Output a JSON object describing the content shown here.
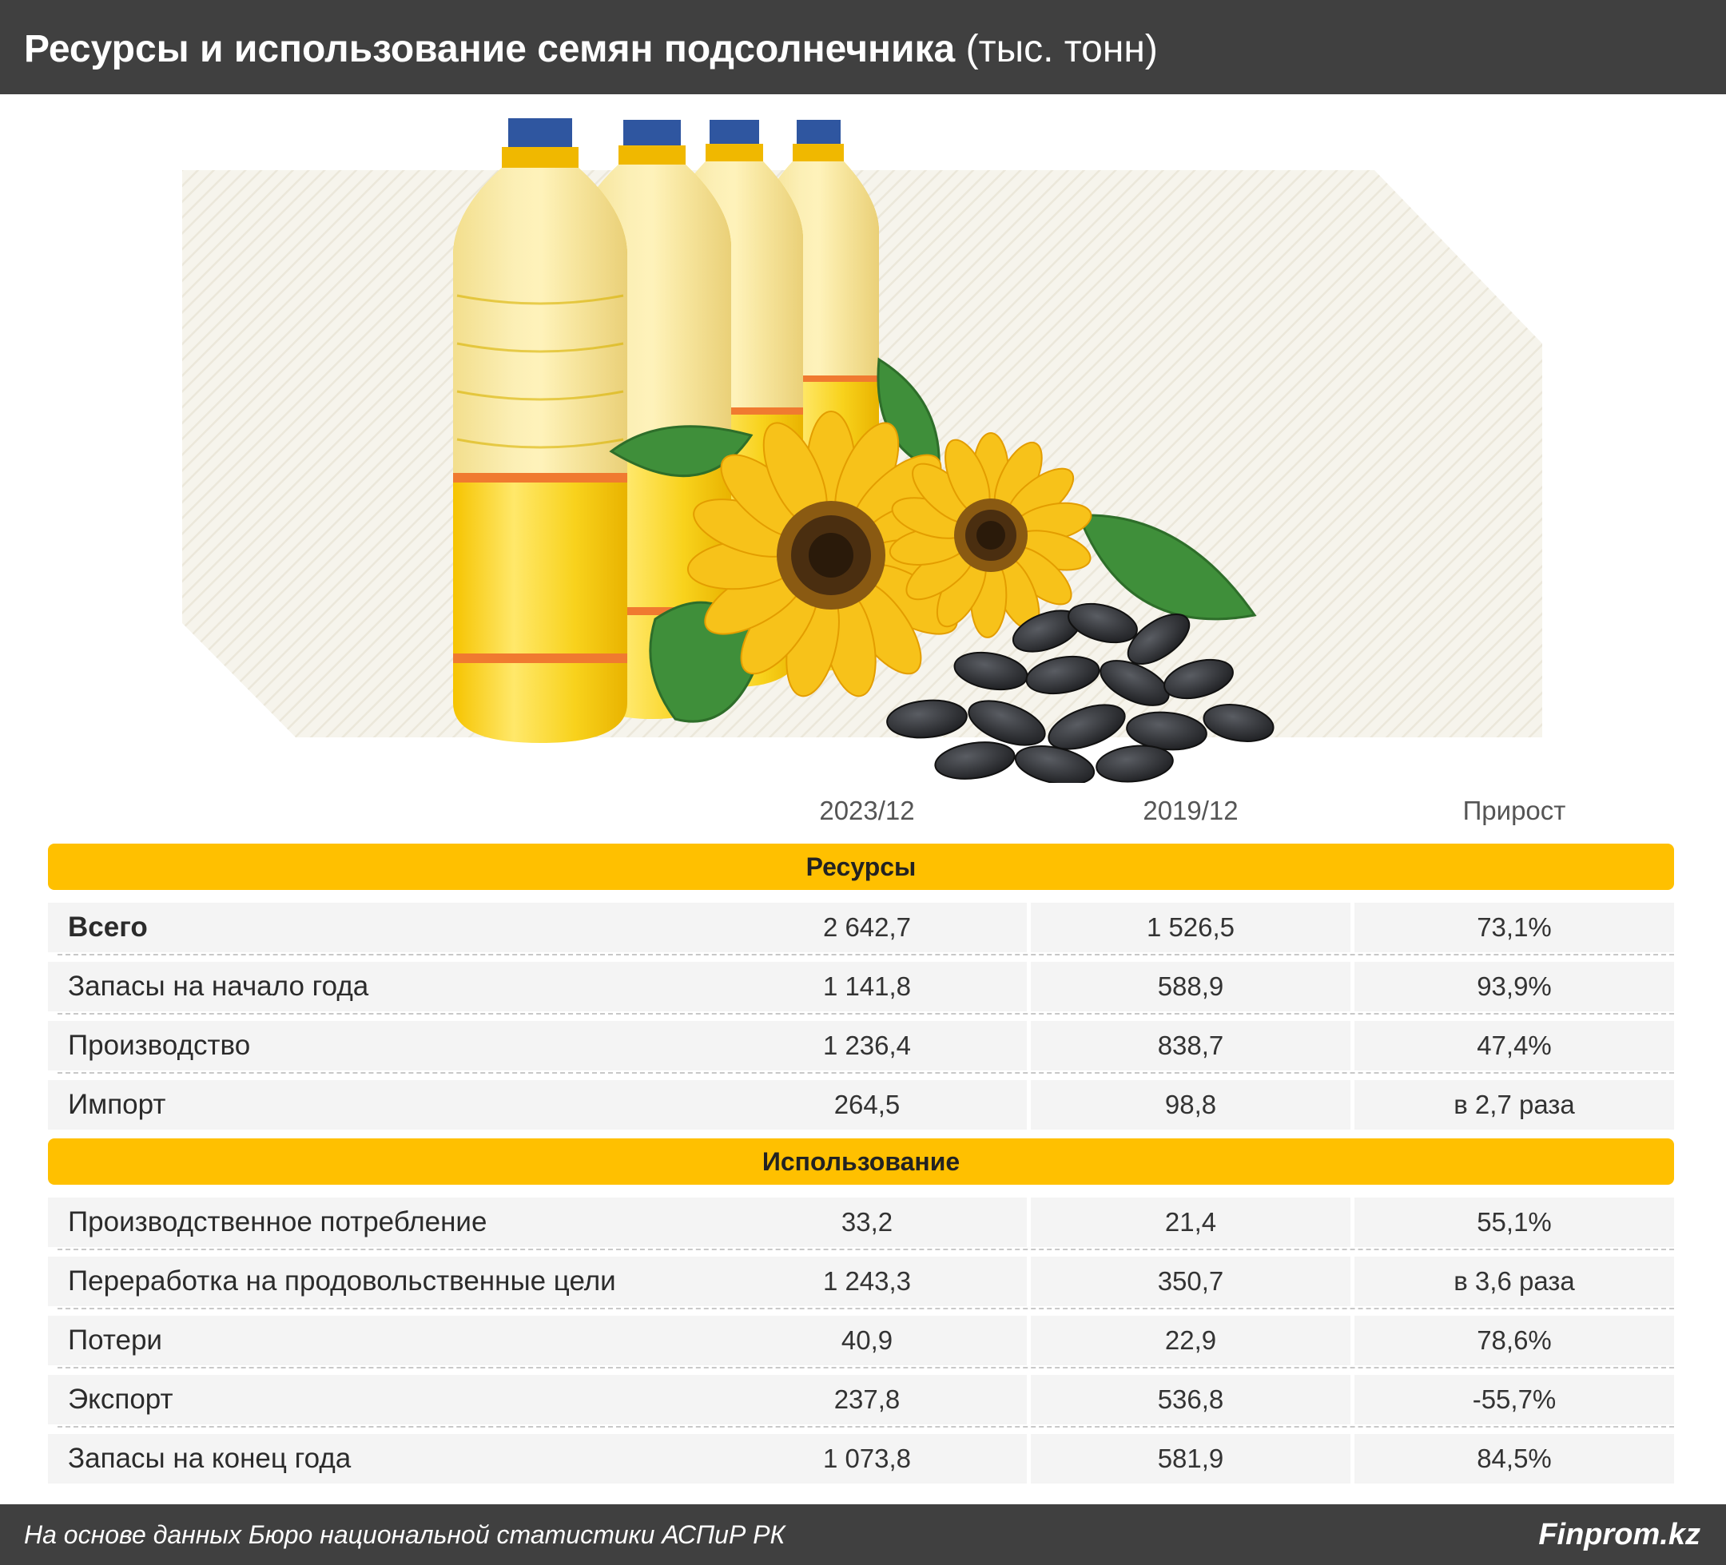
{
  "header": {
    "title_main": "Ресурсы и использование семян подсолнечника",
    "title_unit": "(тыс. тонн)"
  },
  "table": {
    "columns": [
      "2023/12",
      "2019/12",
      "Прирост"
    ],
    "sections": [
      {
        "title": "Ресурсы",
        "rows": [
          {
            "label": "Всего",
            "v2023": "2 642,7",
            "v2019": "1 526,5",
            "growth": "73,1%"
          },
          {
            "label": "Запасы на начало года",
            "v2023": "1 141,8",
            "v2019": "588,9",
            "growth": "93,9%"
          },
          {
            "label": "Производство",
            "v2023": "1 236,4",
            "v2019": "838,7",
            "growth": "47,4%"
          },
          {
            "label": "Импорт",
            "v2023": "264,5",
            "v2019": "98,8",
            "growth": "в 2,7 раза"
          }
        ]
      },
      {
        "title": "Использование",
        "rows": [
          {
            "label": "Производственное потребление",
            "v2023": "33,2",
            "v2019": "21,4",
            "growth": "55,1%"
          },
          {
            "label": "Переработка на продовольственные цели",
            "v2023": "1 243,3",
            "v2019": "350,7",
            "growth": "в 3,6 раза"
          },
          {
            "label": "Потери",
            "v2023": "40,9",
            "v2019": "22,9",
            "growth": "78,6%"
          },
          {
            "label": "Экспорт",
            "v2023": "237,8",
            "v2019": "536,8",
            "growth": "-55,7%"
          },
          {
            "label": "Запасы на конец года",
            "v2023": "1 073,8",
            "v2019": "581,9",
            "growth": "84,5%"
          }
        ]
      }
    ]
  },
  "footer": {
    "source": "На основе данных Бюро национальной статистики АСПиР РК",
    "brand": "Finprom.kz"
  },
  "colors": {
    "header_bg": "#404040",
    "band": "#FFC000",
    "row_bg": "#F4F4F4"
  }
}
